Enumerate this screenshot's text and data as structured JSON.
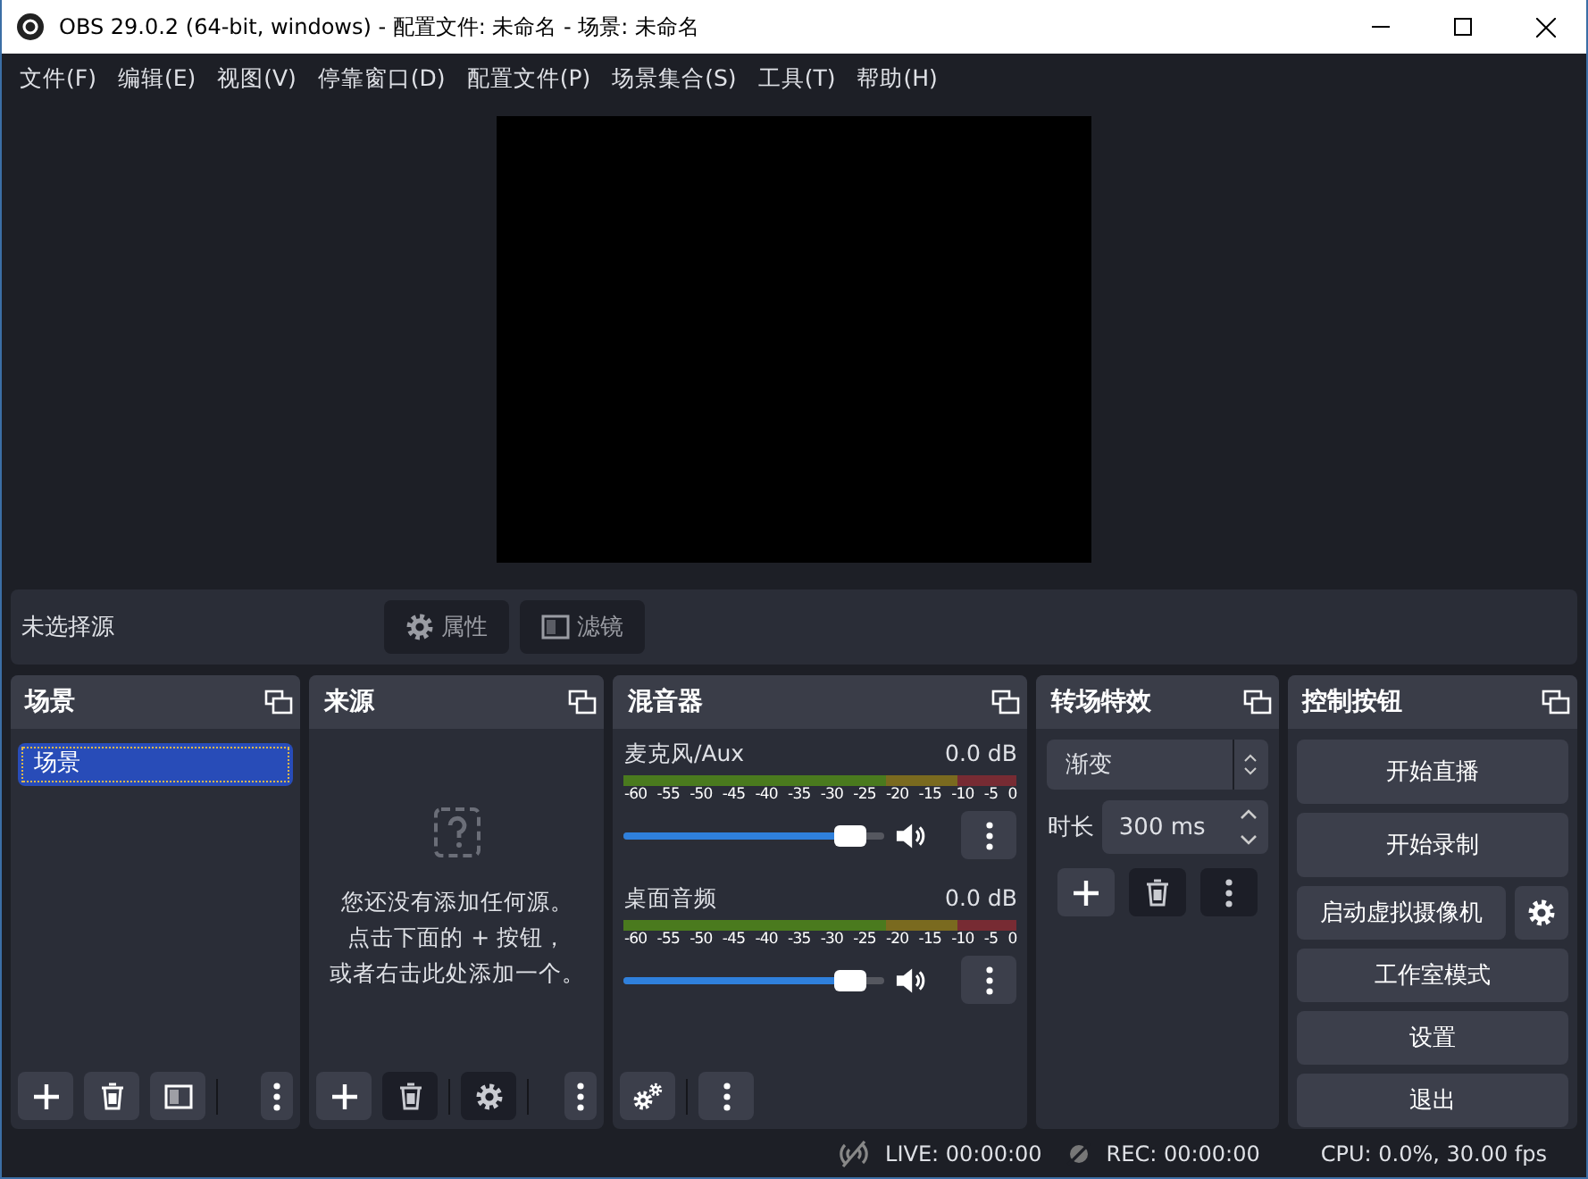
{
  "window": {
    "title": "OBS 29.0.2 (64-bit, windows) - 配置文件: 未命名 - 场景: 未命名"
  },
  "menu": [
    "文件(F)",
    "编辑(E)",
    "视图(V)",
    "停靠窗口(D)",
    "配置文件(P)",
    "场景集合(S)",
    "工具(T)",
    "帮助(H)"
  ],
  "source_bar": {
    "label": "未选择源",
    "buttons": [
      {
        "label": "属性",
        "disabled": true
      },
      {
        "label": "滤镜",
        "disabled": true
      }
    ]
  },
  "scenes": {
    "title": "场景",
    "items": [
      {
        "label": "场景",
        "selected": true
      }
    ],
    "toolbar": [
      {
        "disabled": false
      },
      {
        "disabled": false
      },
      {
        "disabled": false
      },
      {
        "disabled": false
      }
    ]
  },
  "sources": {
    "title": "来源",
    "empty_hint": [
      "您还没有添加任何源。",
      "点击下面的 + 按钮，",
      "或者右击此处添加一个。"
    ],
    "toolbar": [
      {
        "disabled": false
      },
      {
        "disabled": true
      },
      {
        "disabled": true
      },
      {
        "disabled": false
      }
    ]
  },
  "mixer": {
    "title": "混音器",
    "channels": [
      {
        "name": "麦克风/Aux",
        "reading": "0.0 dB",
        "level": 0.93,
        "muted": false,
        "scale": [
          "-60",
          "-55",
          "-50",
          "-45",
          "-40",
          "-35",
          "-30",
          "-25",
          "-20",
          "-15",
          "-10",
          "-5",
          "0"
        ]
      },
      {
        "name": "桌面音频",
        "reading": "0.0 dB",
        "level": 0.93,
        "muted": false,
        "scale": [
          "-60",
          "-55",
          "-50",
          "-45",
          "-40",
          "-35",
          "-30",
          "-25",
          "-20",
          "-15",
          "-10",
          "-5",
          "0"
        ]
      }
    ],
    "toolbar": [
      {
        "disabled": false
      },
      {
        "disabled": false
      }
    ]
  },
  "transitions": {
    "title": "转场特效",
    "selected_transition": "渐变",
    "duration_label": "时长",
    "duration": "300 ms",
    "toolbar": [
      {
        "disabled": false
      },
      {
        "disabled": true
      },
      {
        "disabled": true
      }
    ]
  },
  "controls": {
    "title": "控制按钮",
    "buttons": [
      {
        "label": "开始直播",
        "has_settings": false
      },
      {
        "label": "开始录制",
        "has_settings": false
      },
      {
        "label": "启动虚拟摄像机",
        "has_settings": true
      },
      {
        "label": "工作室模式",
        "has_settings": false
      },
      {
        "label": "设置",
        "has_settings": false
      },
      {
        "label": "退出",
        "has_settings": false
      }
    ]
  },
  "status_bar": {
    "live": "LIVE: 00:00:00",
    "rec": "REC: 00:00:00",
    "cpu": "CPU: 0.0%, 30.00 fps"
  }
}
